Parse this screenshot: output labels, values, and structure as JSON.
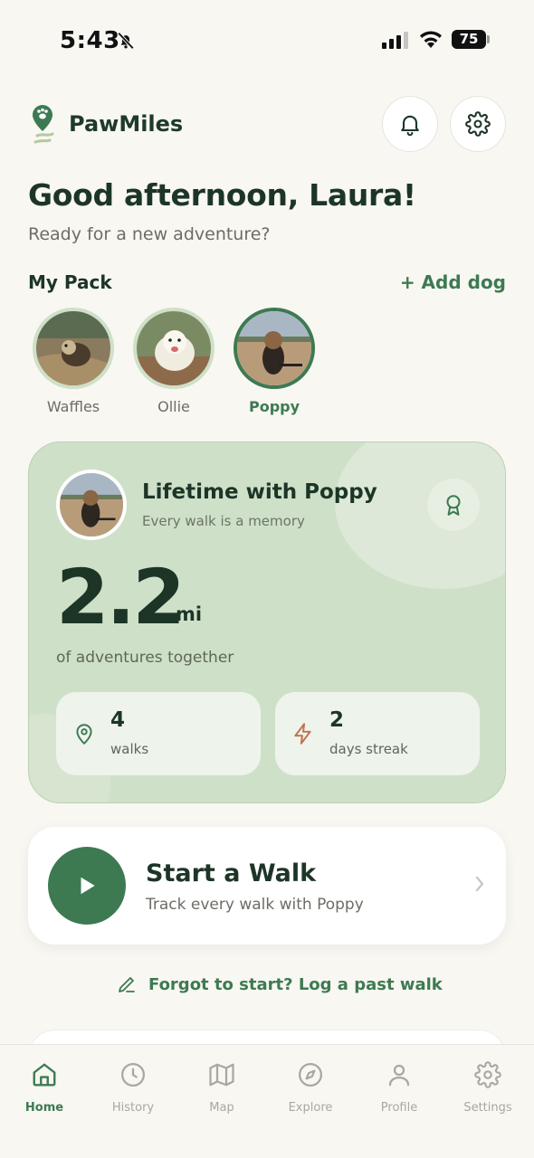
{
  "status_bar": {
    "time": "5:43",
    "battery": "75"
  },
  "brand": {
    "name": "PawMiles"
  },
  "greeting": {
    "title": "Good afternoon, Laura!",
    "subtitle": "Ready for a new adventure?"
  },
  "pack": {
    "title": "My Pack",
    "add_label": "+ Add dog",
    "dogs": [
      {
        "name": "Waffles"
      },
      {
        "name": "Ollie"
      },
      {
        "name": "Poppy",
        "selected": true
      }
    ]
  },
  "lifetime": {
    "title": "Lifetime with Poppy",
    "subtitle": "Every walk is a memory",
    "distance": "2.2",
    "unit": "mi",
    "caption": "of adventures together",
    "stats": [
      {
        "value": "4",
        "label": "walks",
        "icon": "map-pin-icon"
      },
      {
        "value": "2",
        "label": "days streak",
        "icon": "lightning-icon"
      }
    ]
  },
  "start_walk": {
    "title": "Start a Walk",
    "subtitle": "Track every walk with Poppy"
  },
  "log_walk": {
    "label": "Forgot to start? Log a past walk"
  },
  "tabs": [
    {
      "label": "Home",
      "icon": "home-icon",
      "active": true
    },
    {
      "label": "History",
      "icon": "clock-icon"
    },
    {
      "label": "Map",
      "icon": "map-icon"
    },
    {
      "label": "Explore",
      "icon": "compass-icon"
    },
    {
      "label": "Profile",
      "icon": "user-icon"
    },
    {
      "label": "Settings",
      "icon": "gear-icon"
    }
  ],
  "colors": {
    "accent": "#3d7a52",
    "card": "#cfe0c8",
    "background": "#f8f7f2"
  }
}
